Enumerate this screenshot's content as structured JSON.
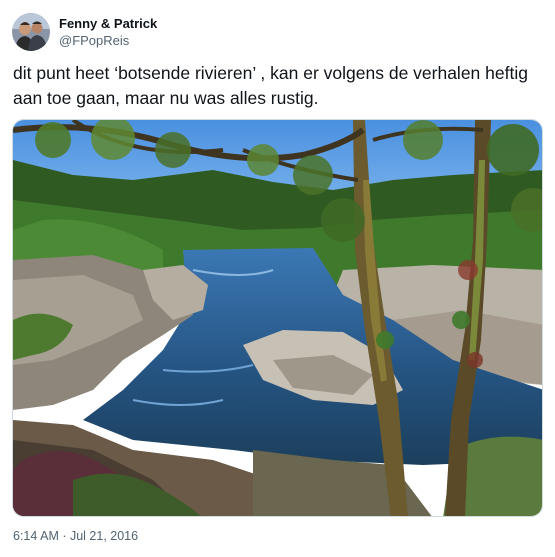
{
  "tweet": {
    "author": {
      "display_name": "Fenny & Patrick",
      "handle": "@FPopReis",
      "avatar_icon": "profile-photo-avatar"
    },
    "text": "dit punt heet ‘botsende rivieren’ , kan er volgens de verhalen heftig aan toe gaan, maar nu was alles rustig.",
    "media": {
      "type": "photo",
      "subject": "river-with-rocks-and-trees-photo"
    },
    "timestamp": "6:14 AM · Jul 21, 2016"
  },
  "colors": {
    "text_primary": "#0f1419",
    "text_secondary": "#536471",
    "border": "#cfd9de",
    "sky": "#5aa0e6",
    "water": "#2d5f95",
    "foliage": "#3f6b2a"
  }
}
